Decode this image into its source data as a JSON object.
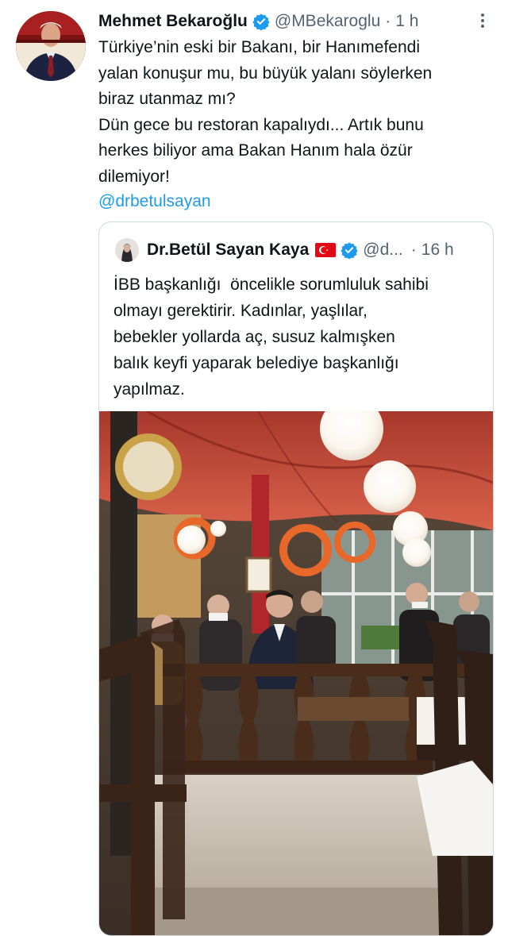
{
  "tweet": {
    "author_name": "Mehmet Bekaroğlu",
    "handle": "@MBekaroglu",
    "separator": "·",
    "time": "1 h",
    "more_icon": "more-vertical-icon",
    "text": "Türkiye’nin eski bir Bakanı, bir Hanımefendi\nyalan konuşur mu, bu büyük yalanı söylerken\nbiraz utanmaz mı?\nDün gece bu restoran kapalıydı... Artık bunu\nherkes biliyor ama Bakan Hanım hala özür\ndilemiyor!",
    "mention": "@drbetulsayan"
  },
  "quoted": {
    "author_name": "Dr.Betül Sayan Kaya",
    "handle": "@d...",
    "separator": "·",
    "time": "16 h",
    "text": "İBB başkanlığı  öncelikle sorumluluk sahibi\nolmayı gerektirir. Kadınlar, yaşlılar,\nbebekler yollarda aç, susuz kalmışken\nbalık keyfi yaparak belediye başkanlığı\nyapılmaz."
  },
  "colors": {
    "link": "#1d9bf0",
    "verified": "#1d9bf0",
    "secondary_text": "#536471",
    "border": "#cfd9de"
  }
}
